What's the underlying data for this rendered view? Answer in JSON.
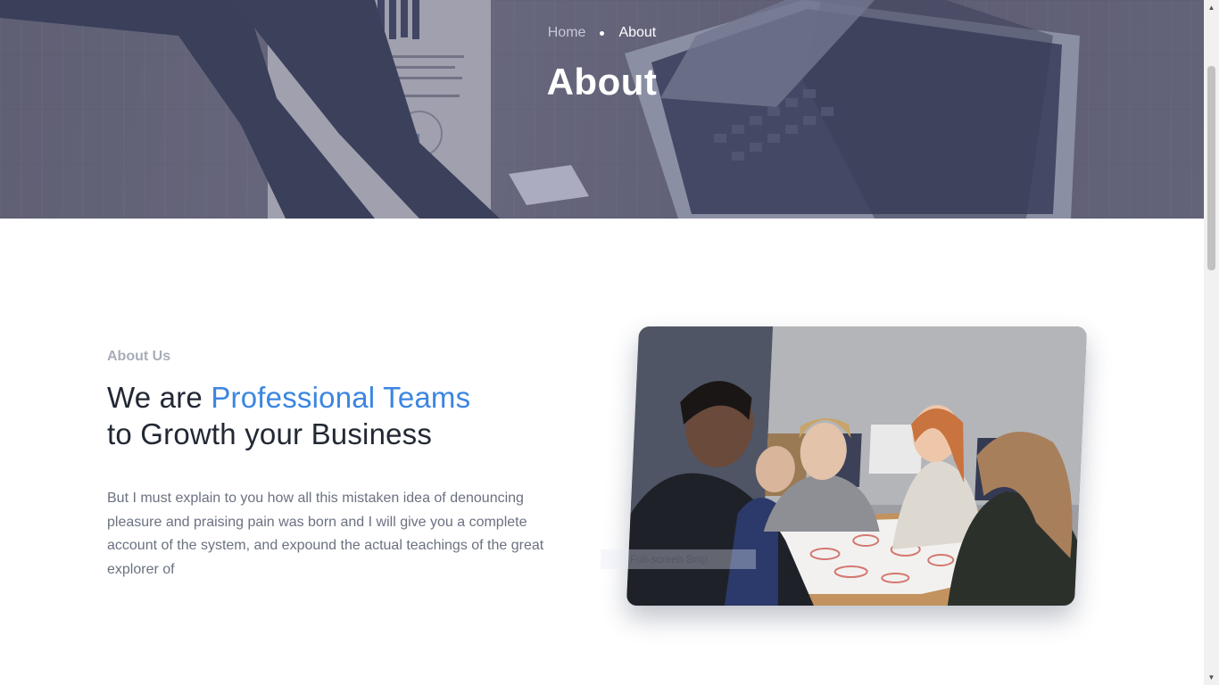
{
  "hero": {
    "breadcrumb": {
      "home_label": "Home",
      "current_label": "About"
    },
    "title": "About"
  },
  "about": {
    "eyebrow": "About Us",
    "heading": {
      "prefix": "We are ",
      "accent": "Professional Teams",
      "line2": "to Growth your Business"
    },
    "paragraph": "But I must explain to you how all this mistaken idea of denouncing pleasure and praising pain was born and I will give you a complete account of the system, and expound the actual teachings of the great explorer of"
  },
  "overlay": {
    "snip_label": "Full-screen Snip"
  },
  "colors": {
    "accent": "#3b86e0",
    "heading": "#222834",
    "body_text": "#6a7180",
    "eyebrow": "#a8adb8",
    "hero_overlay": "#4c5078"
  }
}
